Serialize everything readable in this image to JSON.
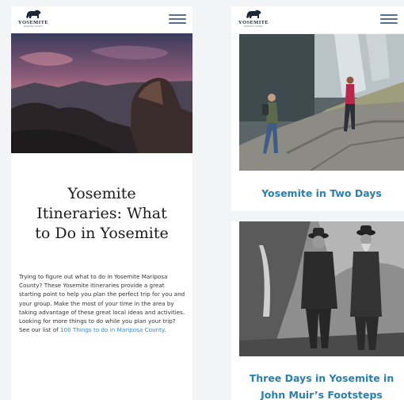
{
  "brand": {
    "logo_text": "YOSEMITE",
    "logo_sub": "MARIPOSA COUNTY"
  },
  "colors": {
    "accent": "#2a7fae",
    "link": "#2e88c8",
    "menu": "#55708d",
    "title": "#1b1b1b"
  },
  "icons": {
    "logo": "bear-icon",
    "menu": "hamburger-menu-icon"
  },
  "article": {
    "title_lines": [
      "Yosemite",
      "Itineraries: What",
      "to Do in Yosemite"
    ],
    "intro": "Trying to figure out what to do in Yosemite Mariposa County? These Yosemite itineraries provide a great starting point to help you plan the perfect trip for you and your group. Make the most of your time in the area by taking advantage of these great local ideas and activities. Looking for more things to do while you plan your trip? See our list of ",
    "intro_link": "100 Things to do in Mariposa County",
    "intro_end": "."
  },
  "cards": [
    {
      "title": "Yosemite in Two Days"
    },
    {
      "title_lines": [
        "Three Days in Yosemite in",
        "John Muir’s Footsteps"
      ]
    }
  ]
}
